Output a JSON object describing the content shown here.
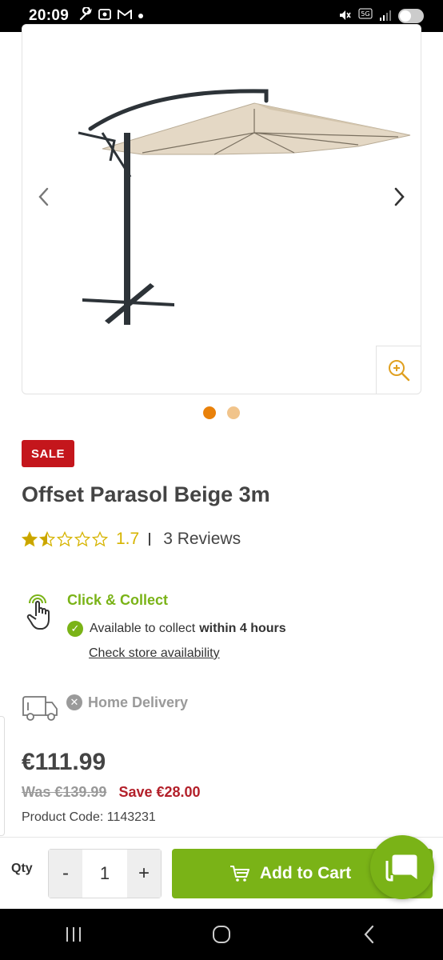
{
  "status_bar": {
    "time": "20:09"
  },
  "product": {
    "sale_badge": "SALE",
    "title": "Offset Parasol Beige 3m",
    "rating_value": "1.7",
    "stars_out_of_5": 1.5,
    "reviews": "3 Reviews",
    "image_index": 0,
    "image_count": 2
  },
  "click_collect": {
    "title": "Click & Collect",
    "available_text": "Available to collect",
    "available_bold": "within 4 hours",
    "store_link": "Check store availability"
  },
  "home_delivery": {
    "label": "Home Delivery"
  },
  "pricing": {
    "price": "€111.99",
    "was": "Was €139.99",
    "save": "Save €28.00",
    "product_code": "Product Code: 1143231"
  },
  "cart": {
    "qty_label": "Qty",
    "minus": "-",
    "qty_value": "1",
    "plus": "+",
    "add_to_cart": "Add to Cart"
  },
  "colors": {
    "accent_green": "#7ab317",
    "sale_red": "#c4161c",
    "dot_active": "#e9810a",
    "dot_inactive": "#f1c48b",
    "rating_yellow": "#d6b400"
  }
}
